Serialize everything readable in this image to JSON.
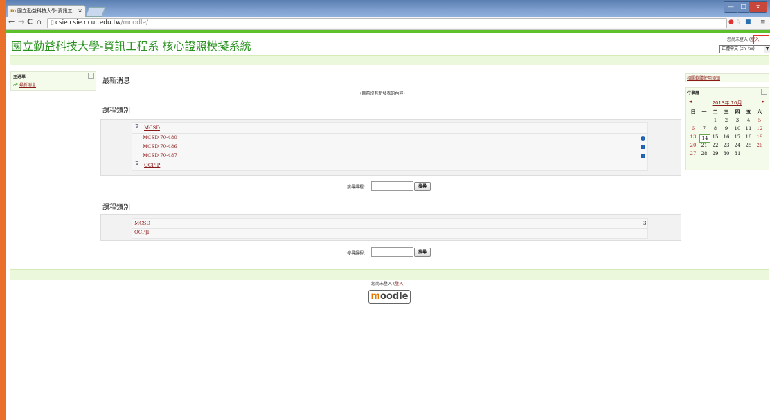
{
  "browser": {
    "tab_title": "國立勤益科技大學-資訊工",
    "tab_icon": "m",
    "tab_close": "×",
    "address_host": "csie.csie.ncut.edu.tw",
    "address_path": "/moodle/",
    "nav_back": "←",
    "nav_forward": "→",
    "nav_reload": "C",
    "nav_home": "⌂",
    "win_min": "—",
    "win_max": "□",
    "win_close": "x"
  },
  "header": {
    "site_title": "國立勤益科技大學-資訊工程系 核心證照模擬系統",
    "login_prefix": "您尚未登入 (",
    "login_link": "登入",
    "login_suffix": ")",
    "language": "正體中文 (zh_tw)"
  },
  "left_block": {
    "title": "主選單",
    "collapse": "−",
    "item": "最新消息"
  },
  "news": {
    "heading": "最新消息",
    "empty": "(目前沒有新發表的內容)"
  },
  "categories1": {
    "heading": "課程類別",
    "items": [
      {
        "label": "MCSD",
        "type": "category"
      },
      {
        "label": "MCSD 70-480",
        "type": "course"
      },
      {
        "label": "MCSD 70-486",
        "type": "course"
      },
      {
        "label": "MCSD 70-487",
        "type": "course"
      },
      {
        "label": "OCPJP",
        "type": "category"
      }
    ],
    "search_label": "搜尋課程:",
    "search_button": "搜尋"
  },
  "categories2": {
    "heading": "課程類別",
    "items": [
      {
        "label": "MCSD",
        "count": "3"
      },
      {
        "label": "OCPJP",
        "count": ""
      }
    ],
    "search_label": "搜尋課程:",
    "search_button": "搜尋"
  },
  "right": {
    "link": "相關軟體使用須知",
    "calendar_title": "行事曆",
    "calendar_month": "2013年 10月",
    "prev": "◄",
    "next": "►",
    "weekdays": [
      "日",
      "一",
      "二",
      "三",
      "四",
      "五",
      "六"
    ],
    "today": "14",
    "weeks": [
      [
        "",
        "",
        "1",
        "2",
        "3",
        "4",
        "5"
      ],
      [
        "6",
        "7",
        "8",
        "9",
        "10",
        "11",
        "12"
      ],
      [
        "13",
        "14",
        "15",
        "16",
        "17",
        "18",
        "19"
      ],
      [
        "20",
        "21",
        "22",
        "23",
        "24",
        "25",
        "26"
      ],
      [
        "27",
        "28",
        "29",
        "30",
        "31",
        "",
        ""
      ]
    ]
  },
  "footer": {
    "login_prefix": "您尚未登入 (",
    "login_link": "登入",
    "login_suffix": ")",
    "logo_m": "m",
    "logo_rest": "oodle"
  },
  "colors": {
    "title_green": "#2a9320",
    "link_red": "#8b1a1a",
    "band_green": "#ecf8dc",
    "top_bar_green": "#5cc02a"
  }
}
